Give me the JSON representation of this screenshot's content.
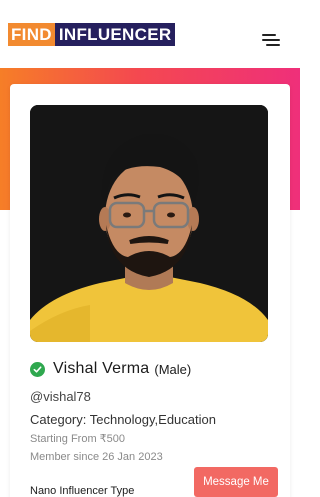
{
  "header": {
    "logo_part1": "FIND",
    "logo_part2": "INFLUENCER",
    "menu_icon": "hamburger-menu-icon"
  },
  "colors": {
    "logo_orange": "#f28a30",
    "logo_navy": "#26205e",
    "gradient_start": "#f67e27",
    "gradient_mid": "#f4494f",
    "gradient_end": "#ef2f7a",
    "verified_green": "#2fa84f",
    "message_button": "#f26963"
  },
  "profile": {
    "photo_icon": "profile-photo",
    "verified_icon": "verified-check-icon",
    "name": "Vishal Verma",
    "gender": "(Male)",
    "handle": "@vishal78",
    "category": "Category: Technology,Education",
    "price": "Starting From ₹500",
    "member_since": "Member since 26 Jan 2023",
    "influencer_type": "Nano Influencer Type",
    "message_button": "Message Me"
  }
}
